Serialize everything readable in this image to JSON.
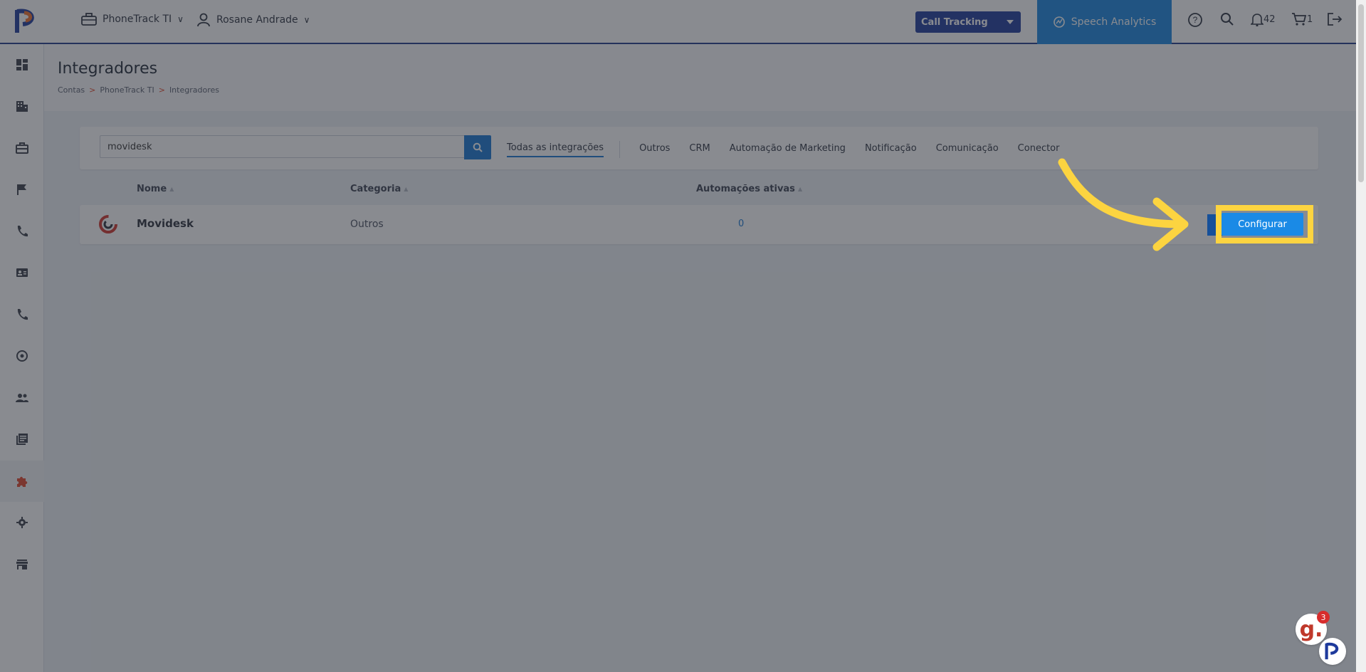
{
  "topbar": {
    "company_label": "PhoneTrack TI",
    "user_label": "Rosane Andrade",
    "product_select": "Call Tracking",
    "speech_label": "Speech Analytics",
    "notifications_count": "42",
    "cart_count": "1"
  },
  "page": {
    "title": "Integradores",
    "breadcrumb": [
      "Contas",
      "PhoneTrack TI",
      "Integradores"
    ],
    "breadcrumb_sep": ">"
  },
  "filters": {
    "search_value": "movidesk",
    "tabs": [
      "Todas as integrações",
      "Outros",
      "CRM",
      "Automação de Marketing",
      "Notificação",
      "Comunicação",
      "Conector"
    ],
    "active_tab": "Todas as integrações"
  },
  "table": {
    "headers": {
      "name": "Nome",
      "category": "Categoria",
      "automations": "Automações ativas"
    },
    "rows": [
      {
        "name": "Movidesk",
        "category": "Outros",
        "automations": "0",
        "action": "Configurar"
      }
    ]
  },
  "widgets": {
    "g_badge": "3",
    "g_letter": "g."
  },
  "colors": {
    "brand_dark": "#1e3a9c",
    "accent": "#1877d2",
    "highlight": "#fcd440"
  }
}
